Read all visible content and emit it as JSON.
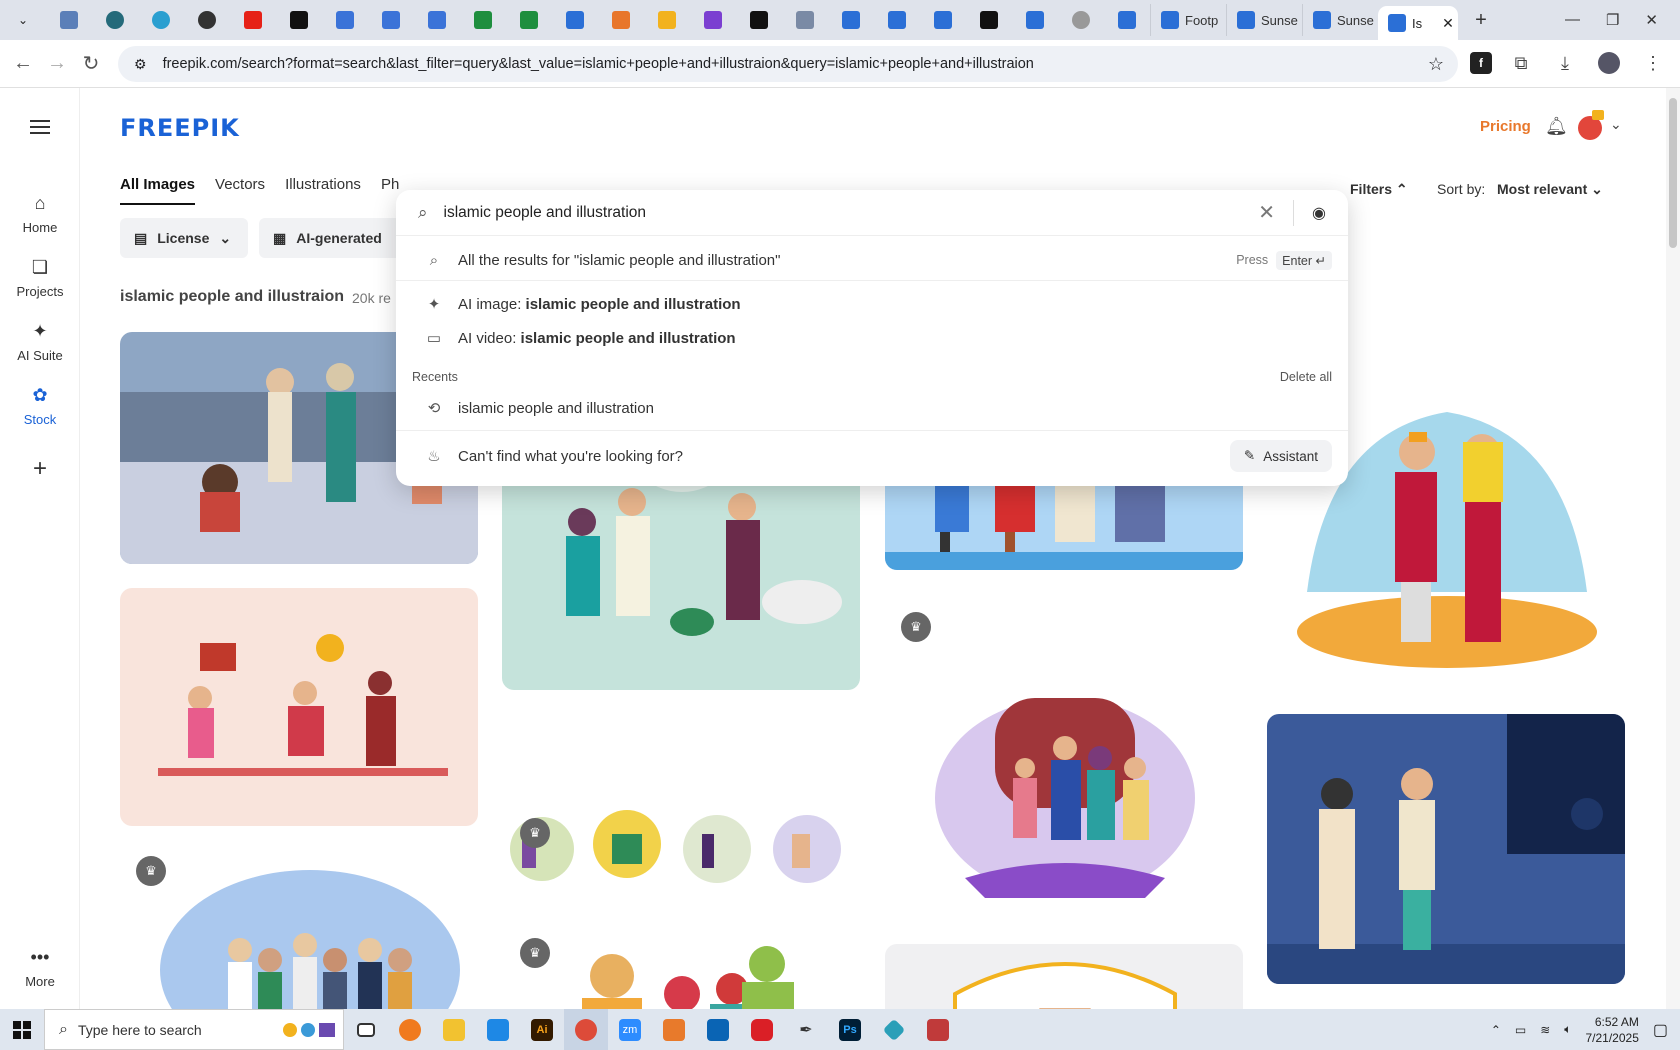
{
  "browser": {
    "url": "freepik.com/search?format=search&last_filter=query&last_value=islamic+people+and+illustraion&query=islamic+people+and+illustraion",
    "tabs": [
      {
        "label": "Footp"
      },
      {
        "label": "Sunse"
      },
      {
        "label": "Sunse"
      },
      {
        "label": "Is"
      }
    ]
  },
  "header": {
    "logo": "FREEPIK",
    "pricing": "Pricing"
  },
  "rail": {
    "items": [
      {
        "label": "Home"
      },
      {
        "label": "Projects"
      },
      {
        "label": "AI Suite"
      },
      {
        "label": "Stock"
      },
      {
        "label": "More"
      }
    ]
  },
  "content_tabs": [
    {
      "label": "All Images"
    },
    {
      "label": "Vectors"
    },
    {
      "label": "Illustrations"
    },
    {
      "label": "Ph"
    }
  ],
  "filters": {
    "license": "License",
    "ai_generated": "AI-generated",
    "filters_label": "Filters",
    "sort_label": "Sort by:",
    "sort_value": "Most relevant"
  },
  "results": {
    "title": "islamic people and illustraion",
    "count": "20k re"
  },
  "search": {
    "query": "islamic people and illustration",
    "all_results": "All the results for \"islamic people and illustration\"",
    "press": "Press",
    "enter": "Enter ↵",
    "ai_image_prefix": "AI image: ",
    "ai_image_query": "islamic people and illustration",
    "ai_video_prefix": "AI video: ",
    "ai_video_query": "islamic people and illustration",
    "recents_label": "Recents",
    "delete_all": "Delete all",
    "recent_item": "islamic people and illustration",
    "cant_find": "Can't find what you're looking for?",
    "assistant": "Assistant"
  },
  "taskbar": {
    "search_placeholder": "Type here to search",
    "time": "6:52 AM",
    "date": "7/21/2025"
  }
}
